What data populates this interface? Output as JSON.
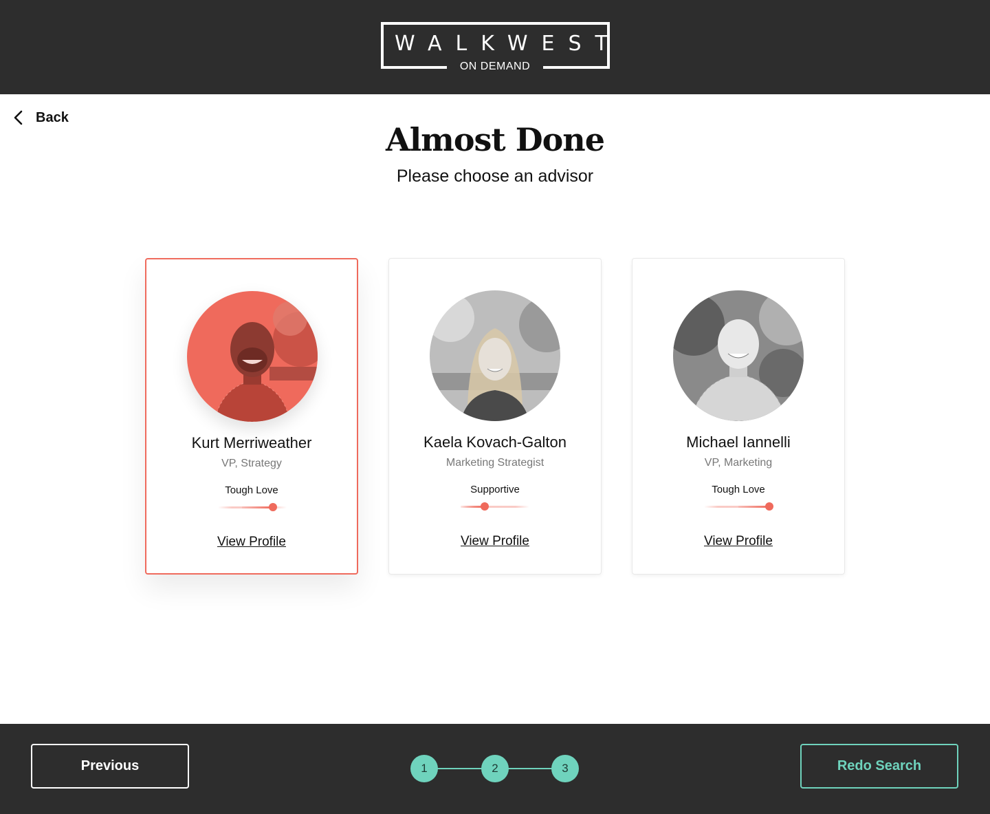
{
  "header": {
    "logo_word": "WALKWEST",
    "logo_sub": "ON DEMAND"
  },
  "nav": {
    "back_label": "Back",
    "back_icon": "chevron-left-icon"
  },
  "title": "Almost Done",
  "subtitle": "Please choose an advisor",
  "advisors": [
    {
      "name": "Kurt Merriweather",
      "role": "VP, Strategy",
      "tone": "Tough Love",
      "tone_level": 0.8,
      "link": "View Profile",
      "selected": true
    },
    {
      "name": "Kaela Kovach-Galton",
      "role": "Marketing Strategist",
      "tone": "Supportive",
      "tone_level": 0.35,
      "link": "View Profile",
      "selected": false
    },
    {
      "name": "Michael Iannelli",
      "role": "VP, Marketing",
      "tone": "Tough Love",
      "tone_level": 0.95,
      "link": "View Profile",
      "selected": false
    }
  ],
  "footer": {
    "previous_label": "Previous",
    "redo_label": "Redo Search",
    "steps": [
      "1",
      "2",
      "3"
    ]
  },
  "colors": {
    "accent": "#ef6a5c",
    "teal": "#6fd3bd",
    "dark": "#2d2d2d"
  }
}
